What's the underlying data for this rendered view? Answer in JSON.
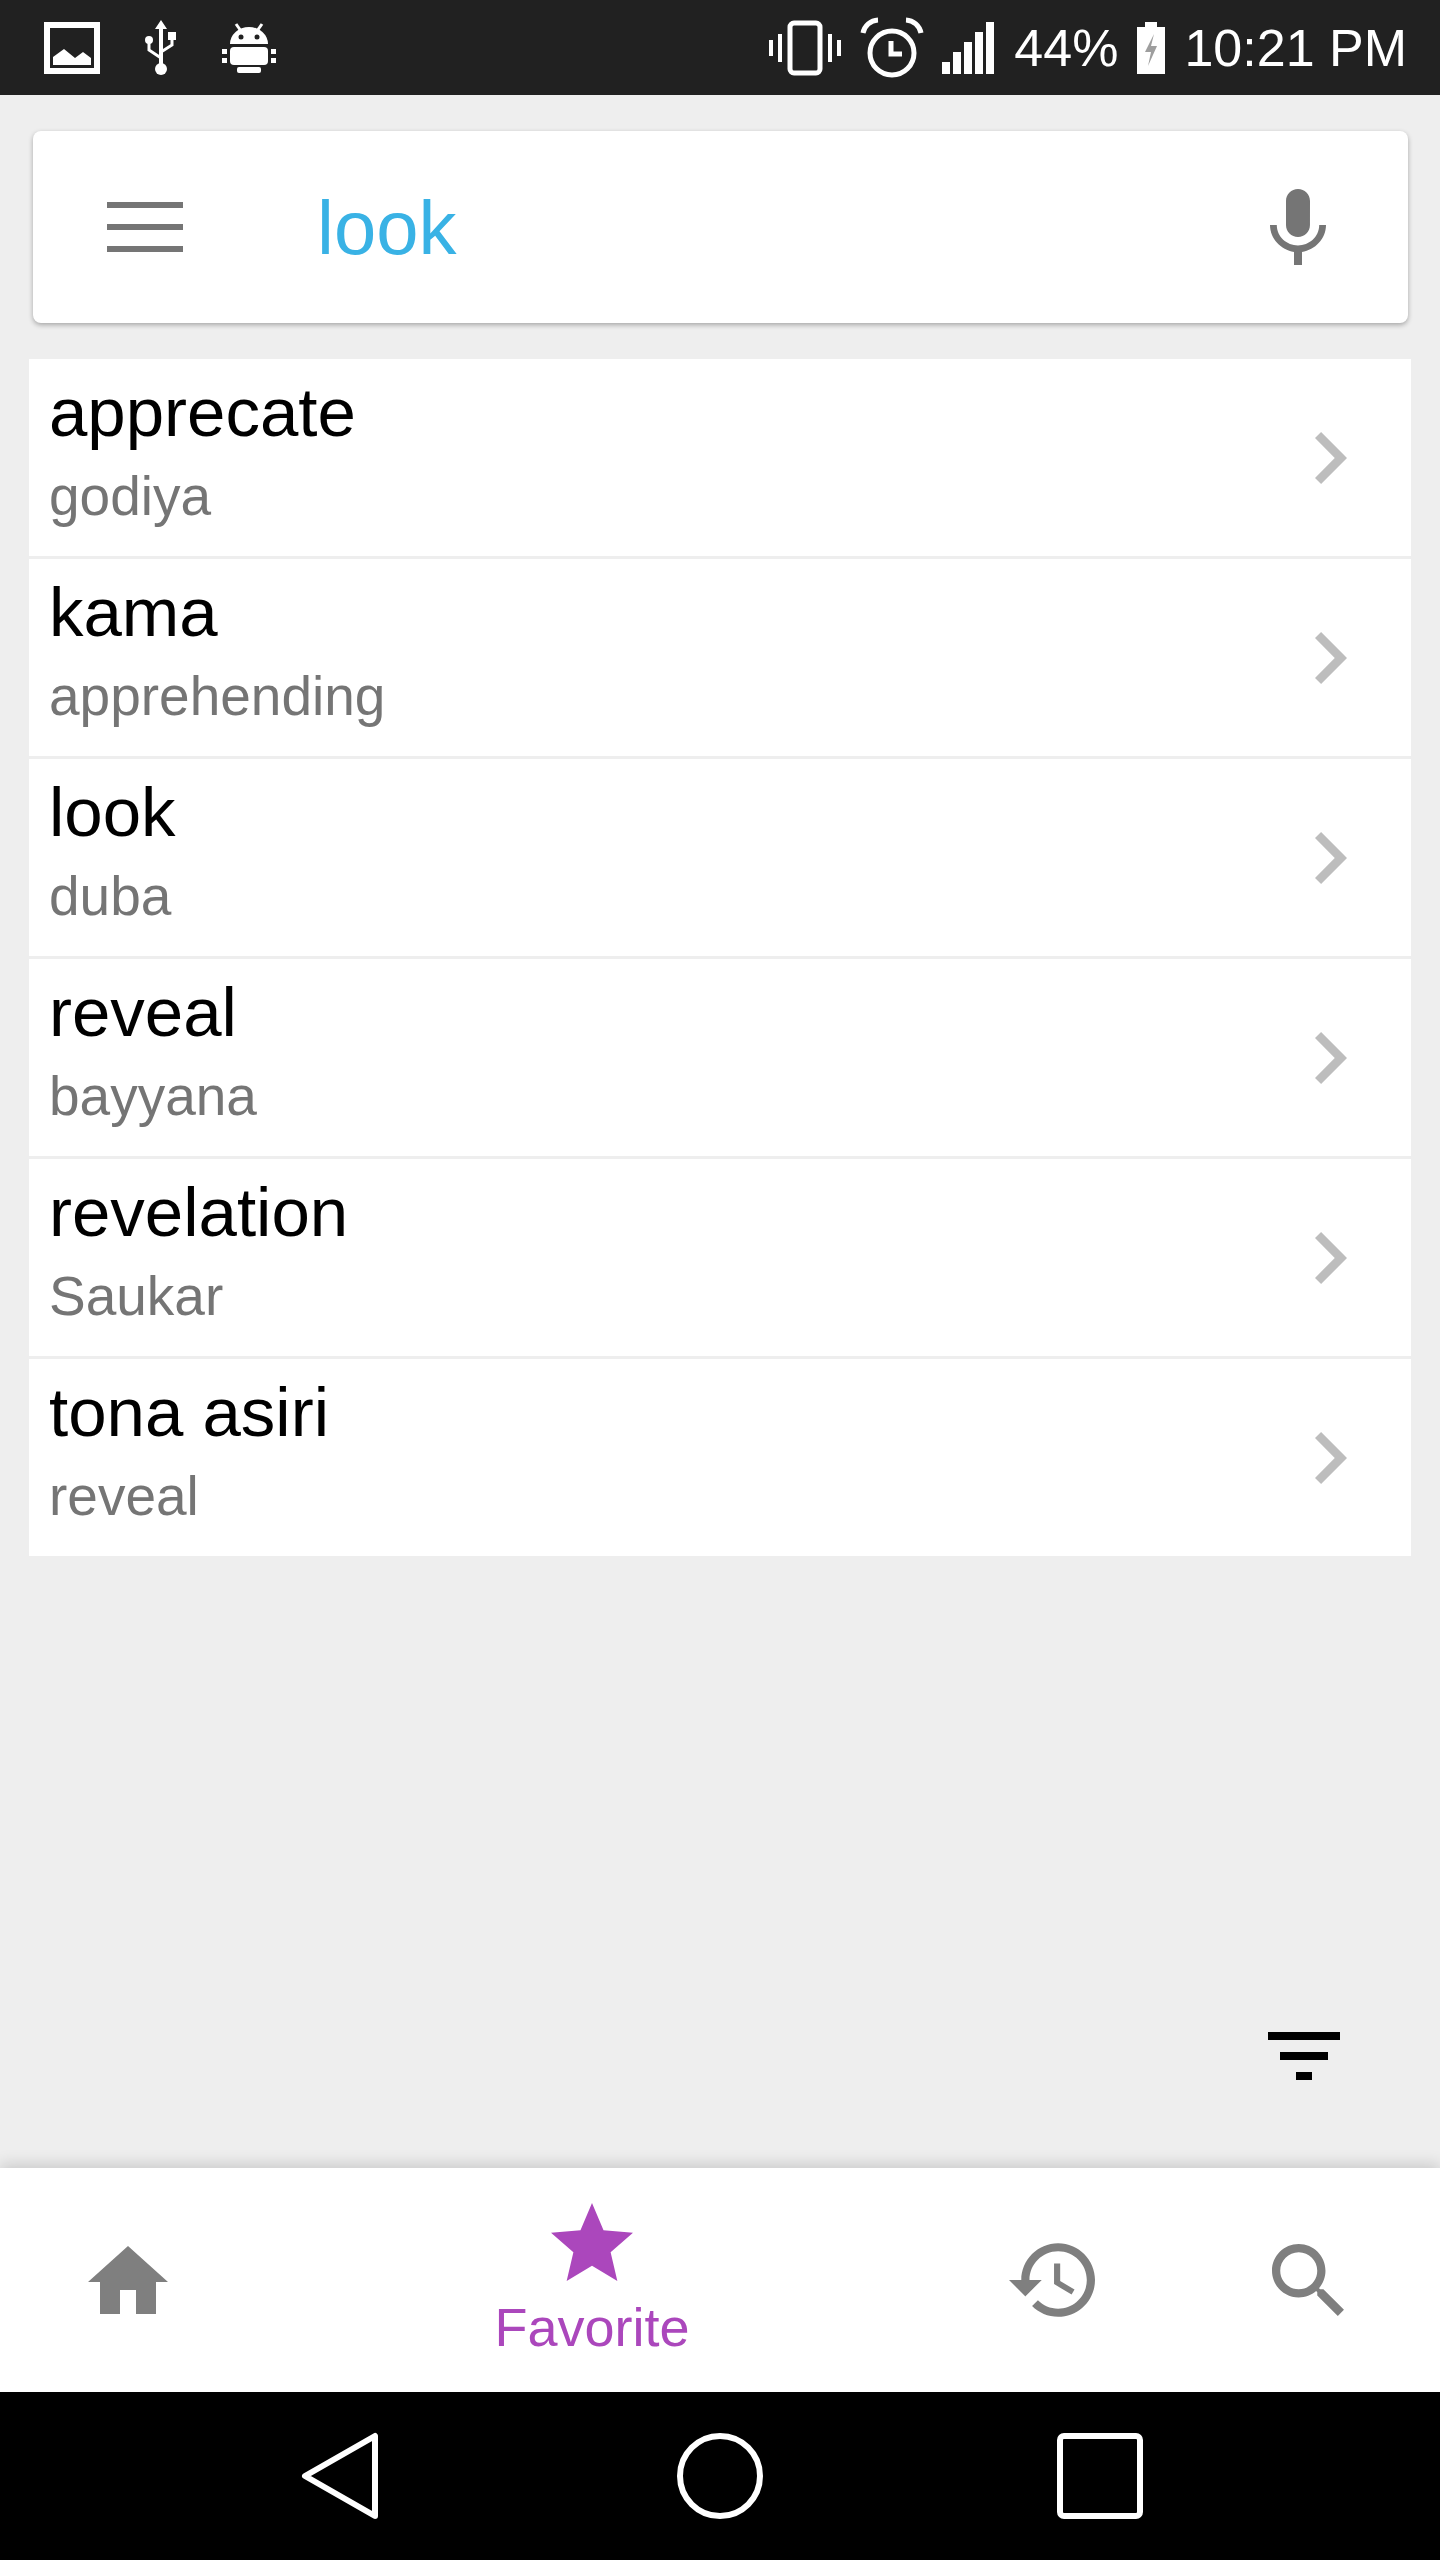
{
  "status_bar": {
    "battery": "44%",
    "time": "10:21 PM"
  },
  "search_bar": {
    "value": "look"
  },
  "favorites": [
    {
      "word": "apprecate",
      "translation": "godiya"
    },
    {
      "word": "kama",
      "translation": "apprehending"
    },
    {
      "word": "look",
      "translation": "duba"
    },
    {
      "word": "reveal",
      "translation": "bayyana"
    },
    {
      "word": "revelation",
      "translation": "Saukar"
    },
    {
      "word": "tona asiri",
      "translation": "reveal"
    }
  ],
  "bottom_nav": [
    {
      "selected": false
    },
    {
      "label": "Favorite",
      "selected": true
    },
    {
      "selected": false
    },
    {
      "selected": false
    }
  ]
}
